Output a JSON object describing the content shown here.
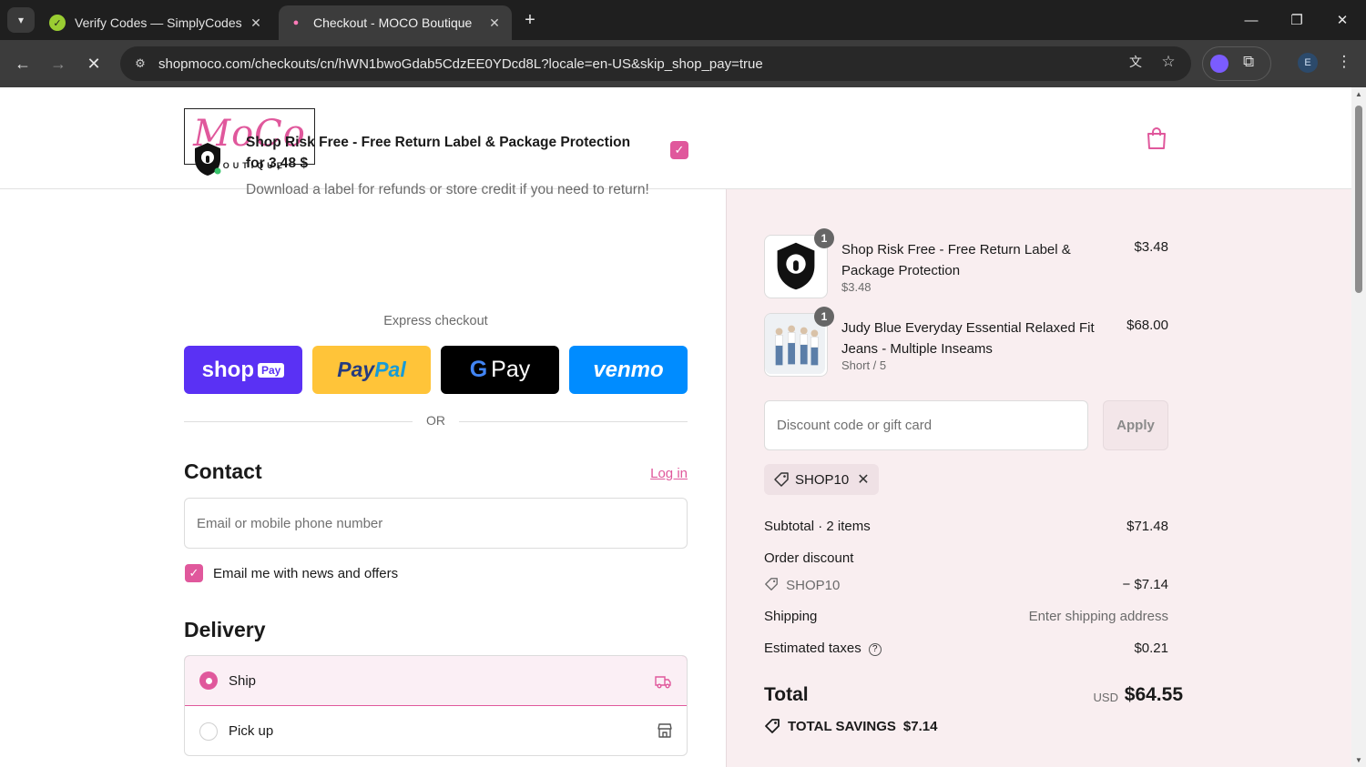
{
  "browser": {
    "tabs": [
      {
        "title": "Verify Codes — SimplyCodes",
        "icon": "simplycodes-icon",
        "active": false
      },
      {
        "title": "Checkout - MOCO Boutique",
        "icon": "moco-favicon",
        "active": true
      }
    ],
    "url": "shopmoco.com/checkouts/cn/hWN1bwoGdab5CdzEE0YDcd8L?locale=en-US&skip_shop_pay=true",
    "profile_initial": "E"
  },
  "header": {
    "logo_mark": "MoCo",
    "logo_sub": "BOUTIQUE"
  },
  "upsell": {
    "title": "Shop Risk Free - Free Return Label & Package Protection for 3,48 $",
    "description": "Download a label for refunds or store credit if you need to return!",
    "checked": true
  },
  "express": {
    "label": "Express checkout",
    "shop_pay": "shop",
    "shop_pay_pill": "Pay",
    "paypal_a": "Pay",
    "paypal_b": "Pal",
    "gpay": "Pay",
    "gpay_g": "G",
    "venmo": "venmo",
    "or": "OR"
  },
  "contact": {
    "heading": "Contact",
    "login": "Log in",
    "email_placeholder": "Email or mobile phone number",
    "newsletter_label": "Email me with news and offers",
    "newsletter_checked": true
  },
  "delivery": {
    "heading": "Delivery",
    "options": [
      {
        "label": "Ship",
        "selected": true,
        "icon": "truck-icon"
      },
      {
        "label": "Pick up",
        "selected": false,
        "icon": "store-icon"
      }
    ]
  },
  "summary": {
    "items": [
      {
        "name": "Shop Risk Free - Free Return Label & Package Protection",
        "variant": "$3.48",
        "price": "$3.48",
        "qty": "1"
      },
      {
        "name": "Judy Blue Everyday Essential Relaxed Fit Jeans - Multiple Inseams",
        "variant": "Short / 5",
        "price": "$68.00",
        "qty": "1"
      }
    ],
    "discount_placeholder": "Discount code or gift card",
    "apply": "Apply",
    "applied_code": "SHOP10",
    "subtotal_label": "Subtotal · 2 items",
    "subtotal": "$71.48",
    "order_discount_label": "Order discount",
    "discount_code": "SHOP10",
    "discount_amount": "− $7.14",
    "shipping_label": "Shipping",
    "shipping_value": "Enter shipping address",
    "taxes_label": "Estimated taxes",
    "taxes": "$0.21",
    "total_label": "Total",
    "currency": "USD",
    "total": "$64.55",
    "savings_label": "TOTAL SAVINGS",
    "savings": "$7.14"
  },
  "colors": {
    "accent": "#e0589c",
    "summary_bg": "#f9eef0"
  }
}
